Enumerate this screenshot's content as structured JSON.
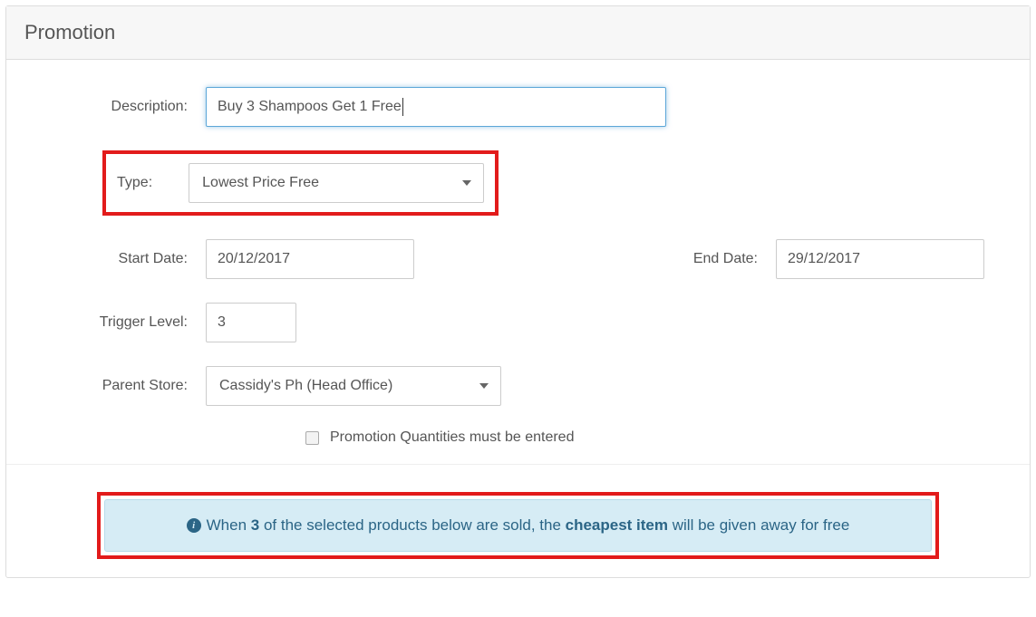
{
  "panel": {
    "title": "Promotion"
  },
  "form": {
    "description_label": "Description:",
    "description_value": "Buy 3 Shampoos Get 1 Free",
    "type_label": "Type:",
    "type_value": "Lowest Price Free",
    "start_date_label": "Start Date:",
    "start_date_value": "20/12/2017",
    "end_date_label": "End Date:",
    "end_date_value": "29/12/2017",
    "trigger_label": "Trigger Level:",
    "trigger_value": "3",
    "parent_store_label": "Parent Store:",
    "parent_store_value": "Cassidy's Ph (Head Office)",
    "quantities_label": "Promotion Quantities must be entered"
  },
  "alert": {
    "pre": "When ",
    "count": "3",
    "mid": " of the selected products below are sold, the ",
    "bold": "cheapest item",
    "post": " will be given away for free"
  },
  "highlights": {
    "type_highlight": true,
    "alert_highlight": true
  }
}
